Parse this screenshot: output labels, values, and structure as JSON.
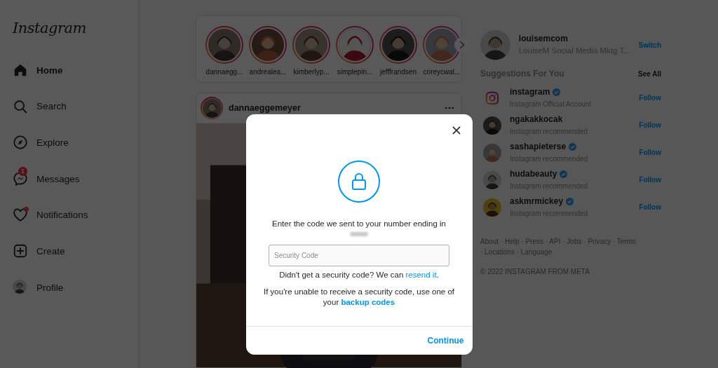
{
  "sidebar": {
    "logo": "Instagram",
    "items": [
      {
        "kind": "home",
        "label": "Home",
        "selected": true
      },
      {
        "kind": "search",
        "label": "Search",
        "selected": false
      },
      {
        "kind": "explore",
        "label": "Explore",
        "selected": false
      },
      {
        "kind": "messages",
        "label": "Messages",
        "selected": false,
        "badge": "1"
      },
      {
        "kind": "notifications",
        "label": "Notifications",
        "selected": false,
        "dot": true
      },
      {
        "kind": "create",
        "label": "Create",
        "selected": false
      },
      {
        "kind": "profile",
        "label": "Profile",
        "selected": false
      }
    ]
  },
  "stories": [
    {
      "username": "dannaegg..."
    },
    {
      "username": "andrealea..."
    },
    {
      "username": "kimberlyp..."
    },
    {
      "username": "simplepin..."
    },
    {
      "username": "jefffrandsen"
    },
    {
      "username": "coreycwal..."
    }
  ],
  "post": {
    "username": "dannaeggemeyer"
  },
  "account": {
    "username": "louisemcom",
    "name": "LouiseM Social Media Mktg T...",
    "action": "Switch"
  },
  "suggestions": {
    "title": "Suggestions For You",
    "see_all": "See All",
    "items": [
      {
        "kind": "brand",
        "username": "instagram",
        "verified": true,
        "subtitle": "Instagram Official Account",
        "action": "Follow"
      },
      {
        "kind": "person",
        "username": "ngakakkocak",
        "verified": false,
        "subtitle": "Instagram recommended",
        "action": "Follow"
      },
      {
        "kind": "person",
        "username": "sashapieterse",
        "verified": true,
        "subtitle": "Instagram recommended",
        "action": "Follow"
      },
      {
        "kind": "person",
        "username": "hudabeauty",
        "verified": true,
        "subtitle": "Instagram recommended",
        "action": "Follow"
      },
      {
        "kind": "person",
        "username": "askmrmickey",
        "verified": true,
        "subtitle": "Instagram recommended",
        "action": "Follow"
      }
    ]
  },
  "footer": {
    "links": "About · Help · Press · API · Jobs · Privacy · Terms · Locations · Language",
    "copyright": "© 2022 INSTAGRAM FROM META"
  },
  "dialog": {
    "message": "Enter the code we sent to your number ending in",
    "code_field": {
      "placeholder": "Security Code"
    },
    "resend": {
      "text": "Didn't get a security code? We can ",
      "link": "resend it",
      "after": "."
    },
    "backup": {
      "text": "If you're unable to receive a security code, use one of your ",
      "link": "backup codes"
    },
    "button": "Continue"
  }
}
